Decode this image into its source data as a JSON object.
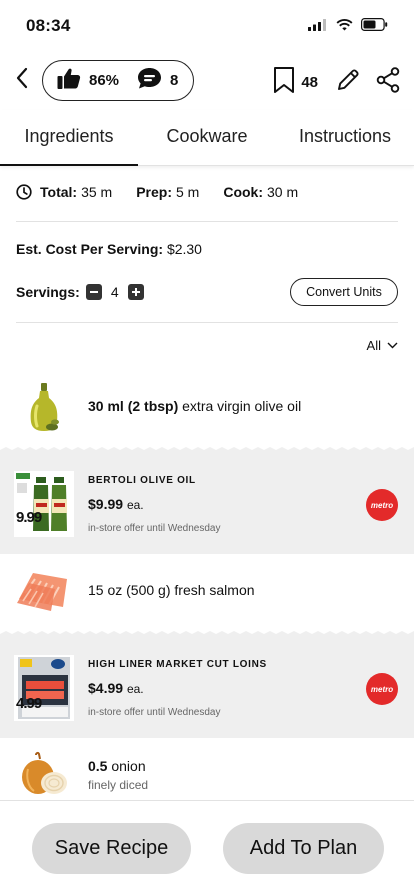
{
  "status_bar": {
    "time": "08:34"
  },
  "header": {
    "likes_percent": "86%",
    "comments_count": "8",
    "bookmarks_count": "48"
  },
  "tabs": [
    {
      "label": "Ingredients",
      "active": true
    },
    {
      "label": "Cookware",
      "active": false
    },
    {
      "label": "Instructions",
      "active": false
    }
  ],
  "times": {
    "total_label": "Total:",
    "total_value": "35 m",
    "prep_label": "Prep:",
    "prep_value": "5 m",
    "cook_label": "Cook:",
    "cook_value": "30 m"
  },
  "cost": {
    "label": "Est. Cost Per Serving:",
    "value": "$2.30"
  },
  "servings": {
    "label": "Servings:",
    "value": "4",
    "convert_label": "Convert Units"
  },
  "filter": {
    "label": "All"
  },
  "ingredients": [
    {
      "amount": "30 ml (2 tbsp)",
      "name": "extra virgin olive oil",
      "icon": "olive-oil-bottle"
    },
    {
      "amount": "",
      "name": "15 oz (500 g) fresh salmon",
      "icon": "salmon-fillet"
    },
    {
      "amount": "0.5",
      "name": "onion",
      "note": "finely diced",
      "icon": "onion"
    }
  ],
  "deals": [
    {
      "name": "BERTOLI OLIVE OIL",
      "price": "$9.99",
      "unit": "ea.",
      "offer": "in-store offer until Wednesday",
      "flyer_price": "9.99",
      "store": "metro"
    },
    {
      "name": "HIGH LINER MARKET CUT LOINS",
      "price": "$4.99",
      "unit": "ea.",
      "offer": "in-store offer until Wednesday",
      "flyer_price": "4.99",
      "store": "metro"
    }
  ],
  "actions": {
    "save_label": "Save Recipe",
    "plan_label": "Add To Plan"
  },
  "colors": {
    "store_badge": "#e32a2a",
    "deal_background": "#efefef",
    "button_background": "#d9d9d9"
  }
}
